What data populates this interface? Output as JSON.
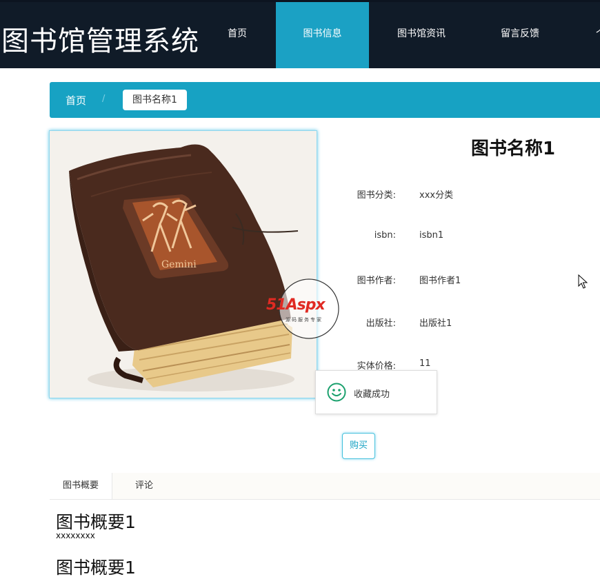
{
  "app": {
    "title": "图书馆管理系统"
  },
  "nav": {
    "items": [
      {
        "label": "首页",
        "active": false
      },
      {
        "label": "图书信息",
        "active": true
      },
      {
        "label": "图书馆资讯",
        "active": false
      },
      {
        "label": "留言反馈",
        "active": false
      },
      {
        "label": "个",
        "active": false
      }
    ]
  },
  "breadcrumb": {
    "home": "首页",
    "current": "图书名称1"
  },
  "book": {
    "name": "图书名称1",
    "fields": [
      {
        "label": "图书分类:",
        "value": "xxx分类"
      },
      {
        "label": "isbn:",
        "value": "isbn1"
      },
      {
        "label": "图书作者:",
        "value": "图书作者1"
      },
      {
        "label": "出版社:",
        "value": "出版社1"
      },
      {
        "label": "实体价格:",
        "value": "11"
      }
    ],
    "cover_caption": "Gemini"
  },
  "watermark": {
    "brand": "51Aspx",
    "tagline": "源码服务专家"
  },
  "toast": {
    "message": "收藏成功",
    "icon": "smiley-icon"
  },
  "actions": {
    "buy_label": "购买"
  },
  "tabs": [
    {
      "label": "图书概要",
      "active": true
    },
    {
      "label": "评论",
      "active": false
    }
  ],
  "summary": {
    "heading": "图书概要1",
    "text": "xxxxxxxx",
    "heading_repeat": "图书概要1"
  },
  "colors": {
    "header_bg": "#101b28",
    "accent": "#17a2c3",
    "nav_active": "#1ba1c4",
    "toast_icon": "#1aa06d"
  }
}
